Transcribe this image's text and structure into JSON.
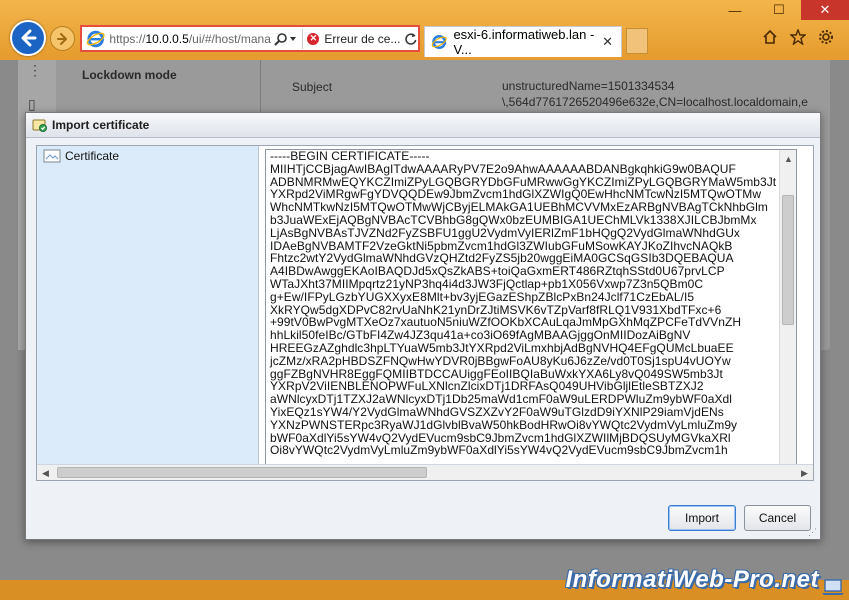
{
  "browser": {
    "address": {
      "scheme": "https://",
      "host": "10.0.0.5",
      "path": "/ui/#/host/mana"
    },
    "cert_error_label": "Erreur de ce...",
    "tab_title": "esxi-6.informatiweb.lan - V...",
    "colors": {
      "frame": "#e8a33a",
      "back_button": "#1b64c4",
      "address_border": "#e74d3c"
    },
    "icons": [
      "back-arrow-icon",
      "forward-arrow-icon",
      "ie-logo-icon",
      "search-icon",
      "dropdown-icon",
      "cert-error-icon",
      "refresh-icon",
      "home-icon",
      "star-icon",
      "gear-icon",
      "minimize-icon",
      "maximize-icon",
      "close-icon"
    ]
  },
  "background_page": {
    "lockdown_label": "Lockdown mode",
    "subject_label": "Subject",
    "subject_value_line1": "unstructuredName=1501334534",
    "subject_value_line2": "\\,564d7761726520496e632e,CN=localhost.localdomain,e"
  },
  "dialog": {
    "title": "Import certificate",
    "tree_item_label": "Certificate",
    "certificate_text": "-----BEGIN CERTIFICATE-----\nMIIHTjCCBjagAwIBAgITdwAAAARyPV7E2o9AhwAAAAAABDANBgkqhkiG9w0BAQUF\nADBNMRMwEQYKCZImiZPyLGQBGRYDbGFuMRwwGgYKCZImiZPyLGQBGRYMaW5mb3Jt\nYXRpd2ViMRgwFgYDVQQDEw9JbmZvcm1hdGlXZWIgQ0EwHhcNMTcwNzI5MTQwOTMw\nWhcNMTkwNzI5MTQwOTMwWjCByjELMAkGA1UEBhMCVVMxEzARBgNVBAgTCkNhbGlm\nb3JuaWExEjAQBgNVBAcTCVBhbG8gQWx0bzEUMBIGA1UEChMLVk1338XJILCBJbmMx\nLjAsBgNVBAsTJVZNd2FyZSBFU1ggU2VydmVyIERlZmF1bHQgQ2VydGlmaWNhdGUx\nIDAeBgNVBAMTF2VzeGktNi5pbmZvcm1hdGl3ZWIubGFuMSowKAYJKoZIhvcNAQkB\nFhtzc2wtY2VydGlmaWNhdGVzQHZtd2FyZS5jb20wggEiMA0GCSqGSIb3DQEBAQUA\nA4IBDwAwggEKAoIBAQDJd5xQsZkABS+toiQaGxmERT486RZtqhSStd0U67prvLCP\nWTaJXht37MIIMpqrtz21yNP3hq4i4d3JW3FjQctlap+pb1X056Vxwp7Z3n5QBm0C\ng+Ew/IFPyLGzbYUGXXyxE8Mlt+bv3yjEGazEShpZBlcPxBn24Jclf71CzEbAL/I5\nXkRYQw5dgXDPvC82rvUaNhK21ynDrZJtiMSVK6vTZpVarf8fRLQ1V931XbdTFxc+6\n+99tV0BwPvgMTXeOz7xautuoN5niuWZfOOKbXCAuLqaJmMpGXhMqZPCFeTdVVnZH\nhhLkil50feIBc/GTbFI4Zw4JZ3qu41a+co3iO69fAgMBAAGjggOnMIIDozAiBgNV\nHREEGzAZghdlc3hpLTYuaW5mb3JtYXRpd2ViLmxhbjAdBgNVHQ4EFgQUMcLbuaEE\njcZMz/xRA2pHBDSZFNQwHwYDVR0jBBgwFoAU8yKu6J6zZe/vd0T0Sj1spU4vUOYw\nggFZBgNVHR8EggFQMIIBTDCCAUiggFEoIIBQIaBuWxkYXA6Ly8vQ049SW5mb3Jt\nYXRpV2ViIENBLENOPWFuLXNlcnZlcixDTj1DRFAsQ049UHVibGljlEtleSBTZXJ2\naWNlcyxDTj1TZXJ2aWNlcyxDTj1Db25maWd1cmF0aW9uLERDPWluZm9ybWF0aXdl\nYixEQz1sYW4/Y2VydGlmaWNhdGVSZXZvY2F0aW9uTGlzdD9iYXNlP29iamVjdENs\nYXNzPWNSTERpc3RyaWJ1dGlvblBvaW50hkBodHRwOi8vYWQtc2VydmVyLmluZm9y\nbWF0aXdlYi5sYW4vQ2VydEVucm9sbC9JbmZvcm1hdGlXZWIlMjBDQSUyMGVkaXRl\nOi8vYWQtc2VydmVyLmluZm9ybWF0aXdlYi5sYW4vQ2VydEVucm9sbC9JbmZvcm1h",
    "import_label": "Import",
    "cancel_label": "Cancel"
  },
  "watermark": "InformatiWeb-Pro.net"
}
